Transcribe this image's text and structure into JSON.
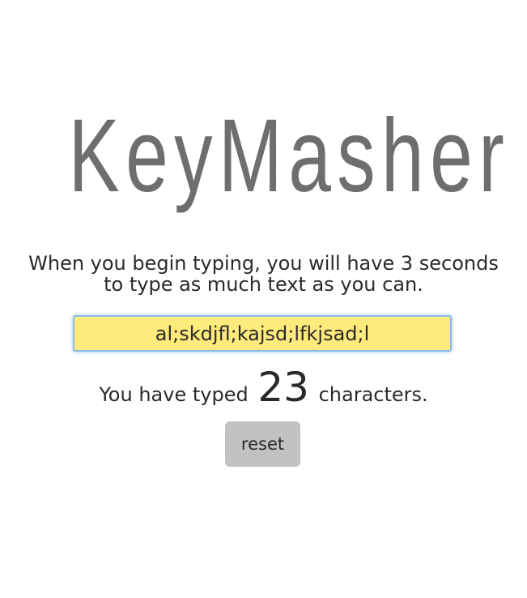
{
  "app": {
    "title": "KeyMasher"
  },
  "instructions": {
    "text": "When you begin typing, you will have 3 seconds to type as much text as you can."
  },
  "input": {
    "value": "al;skdjfl;kajsd;lfkjsad;l"
  },
  "counter": {
    "prefix": "You have typed",
    "count": "23",
    "suffix": "characters."
  },
  "controls": {
    "reset_label": "reset"
  },
  "colors": {
    "title": "#6e6e6e",
    "input_background": "#ffea7c",
    "input_focus_border": "#8bbce6",
    "button_background": "#c2c2c2",
    "text": "#2a2a2a"
  }
}
